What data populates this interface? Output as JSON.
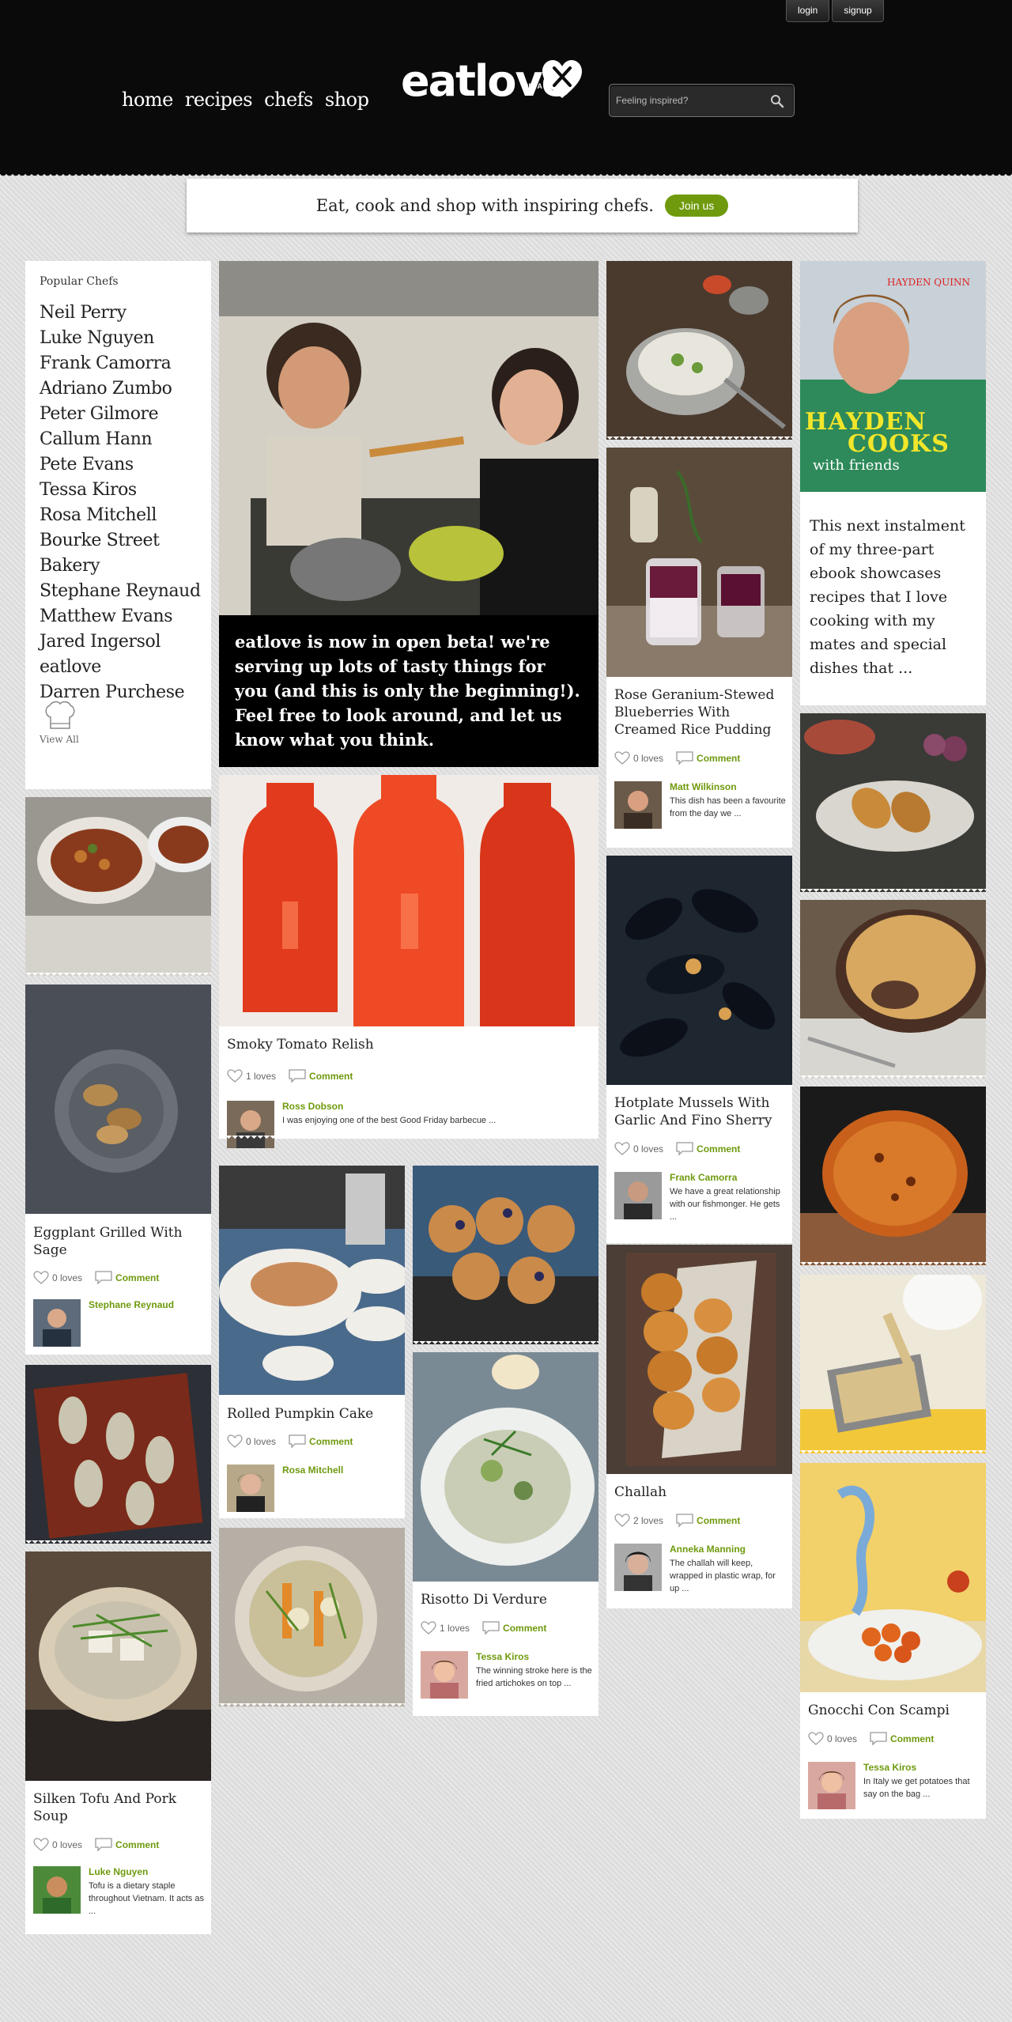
{
  "auth": {
    "login": "login",
    "signup": "signup"
  },
  "nav": {
    "home": "home",
    "recipes": "recipes",
    "chefs": "chefs",
    "shop": "shop"
  },
  "brand": {
    "name": "eatlove",
    "beta": "BETA",
    "accent": "#6f9a0e"
  },
  "search": {
    "placeholder": "Feeling inspired?",
    "icon": "search-icon"
  },
  "banner": {
    "text": "Eat, cook and shop with inspiring chefs.",
    "join_label": "Join us"
  },
  "popular_chefs": {
    "title": "Popular Chefs",
    "chefs": [
      "Neil Perry",
      "Luke Nguyen",
      "Frank Camorra",
      "Adriano Zumbo",
      "Peter Gilmore",
      "Callum Hann",
      "Pete Evans",
      "Tessa Kiros",
      "Rosa Mitchell",
      "Bourke Street Bakery",
      "Stephane Reynaud",
      "Matthew Evans",
      "Jared Ingersol",
      "eatlove",
      "Darren Purchese"
    ],
    "view_all": "View All"
  },
  "hero": {
    "text": "eatlove is now in open beta! we're serving up lots of tasty things for you (and this is only the beginning!). Feel free to look around, and let us know what you think."
  },
  "book": {
    "author": "HAYDEN QUINN",
    "title_line1": "HAYDEN",
    "title_line2": "COOKS",
    "title_line3": "with friends",
    "description": "This next instalment of my three-part ebook showcases recipes that I love cooking with my mates and special dishes that ..."
  },
  "cards": {
    "smoky": {
      "title": "Smoky Tomato Relish",
      "loves": "1 loves",
      "comment": "Comment",
      "author": "Ross Dobson",
      "text": "I was enjoying one of the best Good Friday barbecue ..."
    },
    "eggplant": {
      "title": "Eggplant Grilled With Sage",
      "loves": "0 loves",
      "comment": "Comment",
      "author": "Stephane Reynaud",
      "text": ""
    },
    "rose": {
      "title": "Rose Geranium-Stewed Blueberries With Creamed Rice Pudding",
      "loves": "0 loves",
      "comment": "Comment",
      "author": "Matt Wilkinson",
      "text": "This dish has been a favourite from the day we ..."
    },
    "mussels": {
      "title": "Hotplate Mussels With Garlic And Fino Sherry",
      "loves": "0 loves",
      "comment": "Comment",
      "author": "Frank Camorra",
      "text": "We have a great relationship with our fishmonger. He gets ..."
    },
    "pumpkin": {
      "title": "Rolled Pumpkin Cake",
      "loves": "0 loves",
      "comment": "Comment",
      "author": "Rosa Mitchell",
      "text": ""
    },
    "challah": {
      "title": "Challah",
      "loves": "2 loves",
      "comment": "Comment",
      "author": "Anneka Manning",
      "text": "The challah will keep, wrapped in plastic wrap, for up ..."
    },
    "risotto": {
      "title": "Risotto Di Verdure",
      "loves": "1 loves",
      "comment": "Comment",
      "author": "Tessa Kiros",
      "text": "The winning stroke here is the fried artichokes on top ..."
    },
    "tofu": {
      "title": "Silken Tofu And Pork Soup",
      "loves": "0 loves",
      "comment": "Comment",
      "author": "Luke Nguyen",
      "text": "Tofu is a dietary staple throughout Vietnam. It acts as ..."
    },
    "gnocchi": {
      "title": "Gnocchi Con Scampi",
      "loves": "0 loves",
      "comment": "Comment",
      "author": "Tessa Kiros",
      "text": "In Italy we get potatoes that say on the bag ..."
    }
  }
}
